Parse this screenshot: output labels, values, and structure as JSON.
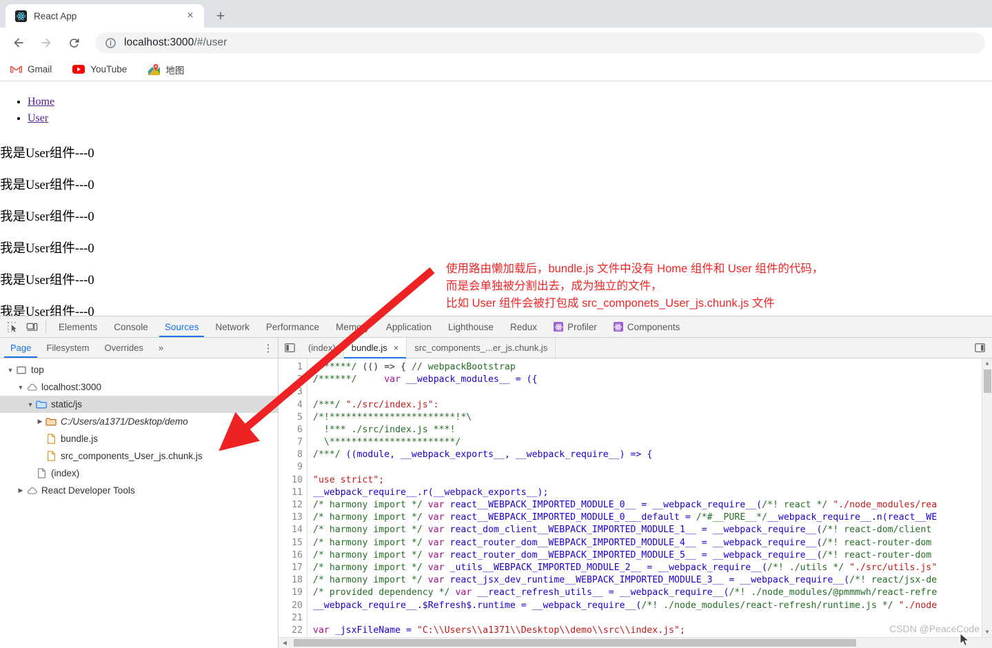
{
  "browser": {
    "tab": {
      "title": "React App",
      "favicon": "react-logo-icon",
      "close_label": "×"
    },
    "new_tab_label": "+",
    "nav": {
      "back": "←",
      "forward": "→",
      "reload": "⟳"
    },
    "omnibox": {
      "host": "localhost:3000",
      "path": "/#/user",
      "full_url": "localhost:3000/#/user",
      "info_icon": "info-circle-icon"
    },
    "bookmarks": [
      {
        "label": "Gmail",
        "icon": "gmail-icon"
      },
      {
        "label": "YouTube",
        "icon": "youtube-icon"
      },
      {
        "label": "地图",
        "icon": "google-maps-icon"
      }
    ]
  },
  "page": {
    "nav_links": [
      {
        "label": "Home",
        "href": "#/home"
      },
      {
        "label": "User",
        "href": "#/user"
      }
    ],
    "paragraphs": [
      "我是User组件---0",
      "我是User组件---0",
      "我是User组件---0",
      "我是User组件---0",
      "我是User组件---0",
      "我是User组件---0"
    ]
  },
  "annotation": {
    "color": "#ef2626",
    "lines": [
      "使用路由懒加载后，bundle.js 文件中没有 Home 组件和 User 组件的代码，",
      "而是会单独被分割出去，成为独立的文件，",
      "比如 User 组件会被打包成 src_componets_User_js.chunk.js 文件"
    ]
  },
  "devtools": {
    "toolbar_icons": [
      {
        "name": "inspect-element-icon"
      },
      {
        "name": "device-toolbar-icon"
      }
    ],
    "tabs": [
      {
        "label": "Elements",
        "active": false,
        "icon": null
      },
      {
        "label": "Console",
        "active": false,
        "icon": null
      },
      {
        "label": "Sources",
        "active": true,
        "icon": null
      },
      {
        "label": "Network",
        "active": false,
        "icon": null
      },
      {
        "label": "Performance",
        "active": false,
        "icon": null
      },
      {
        "label": "Memory",
        "active": false,
        "icon": null
      },
      {
        "label": "Application",
        "active": false,
        "icon": null
      },
      {
        "label": "Lighthouse",
        "active": false,
        "icon": null
      },
      {
        "label": "Redux",
        "active": false,
        "icon": null
      },
      {
        "label": "Profiler",
        "active": false,
        "icon": "react-devtools-icon"
      },
      {
        "label": "Components",
        "active": false,
        "icon": "react-devtools-icon"
      }
    ],
    "navigator": {
      "subtabs": [
        {
          "label": "Page",
          "active": true
        },
        {
          "label": "Filesystem",
          "active": false
        },
        {
          "label": "Overrides",
          "active": false
        },
        {
          "label": "»",
          "active": false
        }
      ],
      "more_label": "⋮",
      "tree": [
        {
          "label": "top",
          "indent": 0,
          "twisty": "▼",
          "icon": "frame-icon",
          "selected": false,
          "italic": false
        },
        {
          "label": "localhost:3000",
          "indent": 1,
          "twisty": "▼",
          "icon": "cloud-icon",
          "selected": false,
          "italic": false
        },
        {
          "label": "static/js",
          "indent": 2,
          "twisty": "▼",
          "icon": "folder-blue-icon",
          "selected": true,
          "italic": false
        },
        {
          "label": "C:/Users/a1371/Desktop/demo",
          "indent": 3,
          "twisty": "▶",
          "icon": "folder-orange-icon",
          "selected": false,
          "italic": true
        },
        {
          "label": "bundle.js",
          "indent": 3,
          "twisty": "",
          "icon": "file-js-icon",
          "selected": false,
          "italic": false
        },
        {
          "label": "src_components_User_js.chunk.js",
          "indent": 3,
          "twisty": "",
          "icon": "file-js-icon",
          "selected": false,
          "italic": false
        },
        {
          "label": "(index)",
          "indent": 2,
          "twisty": "",
          "icon": "file-doc-icon",
          "selected": false,
          "italic": false
        },
        {
          "label": "React Developer Tools",
          "indent": 1,
          "twisty": "▶",
          "icon": "cloud-icon",
          "selected": false,
          "italic": false
        }
      ]
    },
    "file_tabs": {
      "panel_toggle_icon": "show-navigator-icon",
      "expand_icon": "show-debugger-icon",
      "tabs": [
        {
          "label": "(index)",
          "active": false,
          "closable": false
        },
        {
          "label": "bundle.js",
          "active": true,
          "closable": true,
          "close_label": "×"
        },
        {
          "label": "src_components_...er_js.chunk.js",
          "active": false,
          "closable": false
        }
      ]
    },
    "editor": {
      "line_numbers": [
        1,
        2,
        3,
        4,
        5,
        6,
        7,
        8,
        9,
        10,
        11,
        12,
        13,
        14,
        15,
        16,
        17,
        18,
        19,
        20,
        21,
        22
      ],
      "lines": [
        [
          {
            "t": "/******/ ",
            "c": "com"
          },
          {
            "t": "(() => { ",
            "c": "pln"
          },
          {
            "t": "// webpackBootstrap",
            "c": "com"
          }
        ],
        [
          {
            "t": "/******/ ",
            "c": "com"
          },
          {
            "t": "    ",
            "c": "pln"
          },
          {
            "t": "var",
            "c": "kw"
          },
          {
            "t": " __webpack_modules__ = ({",
            "c": "var"
          }
        ],
        [
          {
            "t": "",
            "c": "pln"
          }
        ],
        [
          {
            "t": "/***/ ",
            "c": "com"
          },
          {
            "t": "\"./src/index.js\":",
            "c": "str"
          }
        ],
        [
          {
            "t": "/*!***********************!*\\",
            "c": "com"
          }
        ],
        [
          {
            "t": "  !*** ./src/index.js ***!",
            "c": "com"
          }
        ],
        [
          {
            "t": "  \\***********************/",
            "c": "com"
          }
        ],
        [
          {
            "t": "/***/ ",
            "c": "com"
          },
          {
            "t": "((module, __webpack_exports__, __webpack_require__) => {",
            "c": "var"
          }
        ],
        [
          {
            "t": "",
            "c": "pln"
          }
        ],
        [
          {
            "t": "\"use strict\";",
            "c": "str"
          }
        ],
        [
          {
            "t": "__webpack_require__.r(__webpack_exports__);",
            "c": "var"
          }
        ],
        [
          {
            "t": "/* harmony import */ ",
            "c": "com"
          },
          {
            "t": "var",
            "c": "kw"
          },
          {
            "t": " react__WEBPACK_IMPORTED_MODULE_0__ = __webpack_require__(",
            "c": "var"
          },
          {
            "t": "/*! react */",
            "c": "com"
          },
          {
            "t": " ",
            "c": "pln"
          },
          {
            "t": "\"./node_modules/rea",
            "c": "str"
          }
        ],
        [
          {
            "t": "/* harmony import */ ",
            "c": "com"
          },
          {
            "t": "var",
            "c": "kw"
          },
          {
            "t": " react__WEBPACK_IMPORTED_MODULE_0___default = ",
            "c": "var"
          },
          {
            "t": "/*#__PURE__*/",
            "c": "com"
          },
          {
            "t": "__webpack_require__.n(react__WE",
            "c": "var"
          }
        ],
        [
          {
            "t": "/* harmony import */ ",
            "c": "com"
          },
          {
            "t": "var",
            "c": "kw"
          },
          {
            "t": " react_dom_client__WEBPACK_IMPORTED_MODULE_1__ = __webpack_require__(",
            "c": "var"
          },
          {
            "t": "/*! react-dom/client",
            "c": "com"
          }
        ],
        [
          {
            "t": "/* harmony import */ ",
            "c": "com"
          },
          {
            "t": "var",
            "c": "kw"
          },
          {
            "t": " react_router_dom__WEBPACK_IMPORTED_MODULE_4__ = __webpack_require__(",
            "c": "var"
          },
          {
            "t": "/*! react-router-dom",
            "c": "com"
          }
        ],
        [
          {
            "t": "/* harmony import */ ",
            "c": "com"
          },
          {
            "t": "var",
            "c": "kw"
          },
          {
            "t": " react_router_dom__WEBPACK_IMPORTED_MODULE_5__ = __webpack_require__(",
            "c": "var"
          },
          {
            "t": "/*! react-router-dom",
            "c": "com"
          }
        ],
        [
          {
            "t": "/* harmony import */ ",
            "c": "com"
          },
          {
            "t": "var",
            "c": "kw"
          },
          {
            "t": " _utils__WEBPACK_IMPORTED_MODULE_2__ = __webpack_require__(",
            "c": "var"
          },
          {
            "t": "/*! ./utils */",
            "c": "com"
          },
          {
            "t": " ",
            "c": "pln"
          },
          {
            "t": "\"./src/utils.js\"",
            "c": "str"
          }
        ],
        [
          {
            "t": "/* harmony import */ ",
            "c": "com"
          },
          {
            "t": "var",
            "c": "kw"
          },
          {
            "t": " react_jsx_dev_runtime__WEBPACK_IMPORTED_MODULE_3__ = __webpack_require__(",
            "c": "var"
          },
          {
            "t": "/*! react/jsx-de",
            "c": "com"
          }
        ],
        [
          {
            "t": "/* provided dependency */ ",
            "c": "com"
          },
          {
            "t": "var",
            "c": "kw"
          },
          {
            "t": " __react_refresh_utils__ = __webpack_require__(",
            "c": "var"
          },
          {
            "t": "/*! ./node_modules/@pmmmwh/react-refre",
            "c": "com"
          }
        ],
        [
          {
            "t": "__webpack_require__.$Refresh$.runtime = __webpack_require__(",
            "c": "var"
          },
          {
            "t": "/*! ./node_modules/react-refresh/runtime.js */",
            "c": "com"
          },
          {
            "t": " ",
            "c": "pln"
          },
          {
            "t": "\"./node",
            "c": "str"
          }
        ],
        [
          {
            "t": "",
            "c": "pln"
          }
        ],
        [
          {
            "t": "var",
            "c": "kw"
          },
          {
            "t": " _jsxFileName = ",
            "c": "var"
          },
          {
            "t": "\"C:\\\\Users\\\\a1371\\\\Desktop\\\\demo\\\\src\\\\index.js\";",
            "c": "str"
          }
        ]
      ]
    },
    "scrollbars": {
      "v_up": "▲",
      "v_down": "▼",
      "h_left": "◀"
    }
  },
  "watermark": "CSDN @PeaceCode"
}
